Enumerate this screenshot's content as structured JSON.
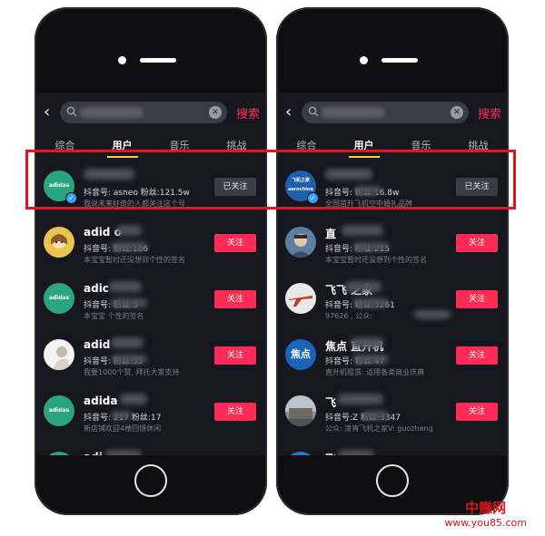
{
  "phones": [
    {
      "search": {
        "back": "‹",
        "clear": "×",
        "button": "搜索"
      },
      "tabs": [
        "综合",
        "用户",
        "音乐",
        "挑战"
      ],
      "users": [
        {
          "avatar_text": "adidas neo",
          "avatar_color": "#2aa57d",
          "name": "",
          "meta": "抖音号: asneo  粉丝:121.5w",
          "sig": "我说未来好奇的人都关注这个号",
          "button": "已关注",
          "followed": true,
          "verified": true
        },
        {
          "avatar_text": "",
          "avatar_color": "#e9c54d",
          "name": "adid  o",
          "meta": "抖音号:      粉丝:106",
          "sig": "本宝宝暂时还没想到个性的签名",
          "button": "关注",
          "followed": false,
          "verified": false
        },
        {
          "avatar_text": "adidas neo",
          "avatar_color": "#2aa57d",
          "name": "adic",
          "meta": "抖音号:      粉丝:3",
          "sig": "本宝宝      个性的签名",
          "button": "关注",
          "followed": false,
          "verified": false
        },
        {
          "avatar_text": "",
          "avatar_color": "#f3f3f3",
          "name": "adid",
          "meta": "抖音号:      粉丝:35",
          "sig": "我要1000个赞, 拜托大家支持",
          "button": "关注",
          "followed": false,
          "verified": false
        },
        {
          "avatar_text": "adidas neo",
          "avatar_color": "#2aa57d",
          "name": "adida",
          "meta": "抖音号:   217  粉丝:17",
          "sig": "新店铺欢迎4楼回馈休闲",
          "button": "关注",
          "followed": false,
          "verified": false
        },
        {
          "avatar_text": "",
          "avatar_color": "#2aa57d",
          "name": "adi",
          "meta": "",
          "sig": "",
          "button": "",
          "followed": false,
          "verified": false
        }
      ]
    },
    {
      "search": {
        "back": "‹",
        "clear": "×",
        "button": "搜索"
      },
      "tabs": [
        "综合",
        "用户",
        "音乐",
        "挑战"
      ],
      "users": [
        {
          "avatar_text": "飞机之家 aerochina",
          "avatar_color": "#1f5fae",
          "name": "",
          "meta": "抖音号:      粉丝:16.8w",
          "sig": "全国首升飞机空中婚礼品牌",
          "button": "已关注",
          "followed": true,
          "verified": true
        },
        {
          "avatar_text": "",
          "avatar_color": "#5b7fa6",
          "name": "直",
          "meta": "抖音号:      粉丝:215",
          "sig": "本宝宝暂时还没想到个性的签名",
          "button": "关注",
          "followed": false,
          "verified": false
        },
        {
          "avatar_text": "",
          "avatar_color": "#e8e8e8",
          "name": "飞飞    之家",
          "meta": "抖音号:      粉丝:3261",
          "sig": "97626    , 公众:",
          "button": "关注",
          "followed": false,
          "verified": false
        },
        {
          "avatar_text": "焦点",
          "avatar_color": "#1b64b8",
          "name": "焦点      直升机",
          "meta": "抖音号:      粉丝:47",
          "sig": "直升机租赁: 适用各类商业庆典",
          "button": "关注",
          "followed": false,
          "verified": false
        },
        {
          "avatar_text": "",
          "avatar_color": "#8a8f96",
          "name": "飞",
          "meta": "抖音号:Z     粉丝:3347",
          "sig": "公众: 凌宵飞机之家V: guozheng",
          "button": "关注",
          "followed": false,
          "verified": false
        },
        {
          "avatar_text": "",
          "avatar_color": "#2f6fd0",
          "name": "飞",
          "meta": "",
          "sig": "",
          "button": "",
          "followed": false,
          "verified": false
        }
      ]
    }
  ],
  "watermark": {
    "title": "中赚网",
    "url": "www.you85.com"
  }
}
